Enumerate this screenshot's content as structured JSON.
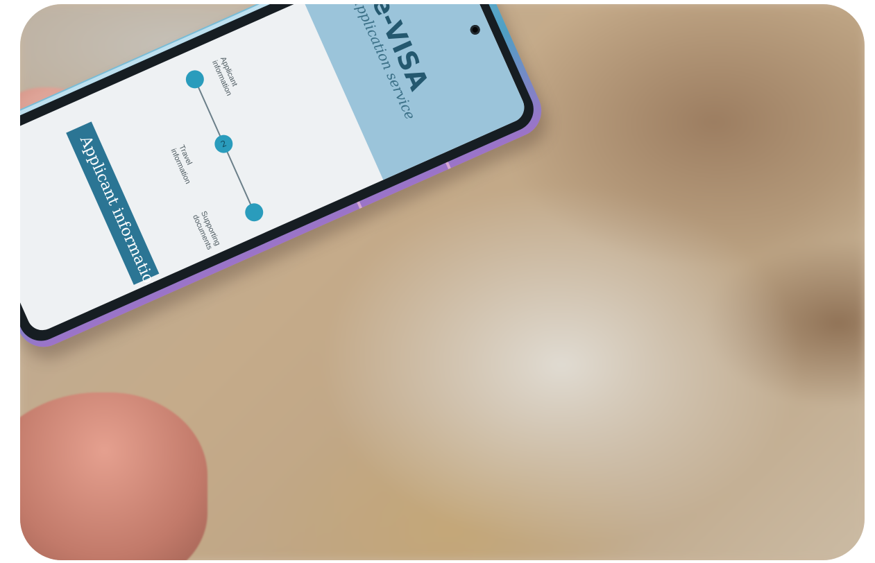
{
  "screen": {
    "title": "e-VISA",
    "subtitle": "application service",
    "steps": [
      {
        "label": "Applicant\ninformation",
        "number": ""
      },
      {
        "label": "Travel\ninformation",
        "number": "2"
      },
      {
        "label": "Supporting\ndocuments",
        "number": ""
      }
    ],
    "section_title": "Applicant information"
  },
  "colors": {
    "accent": "#2a9cbc",
    "header_band": "#9bc4da",
    "section_bar": "#2b7594",
    "phone_frame": "#5aa8cb"
  }
}
